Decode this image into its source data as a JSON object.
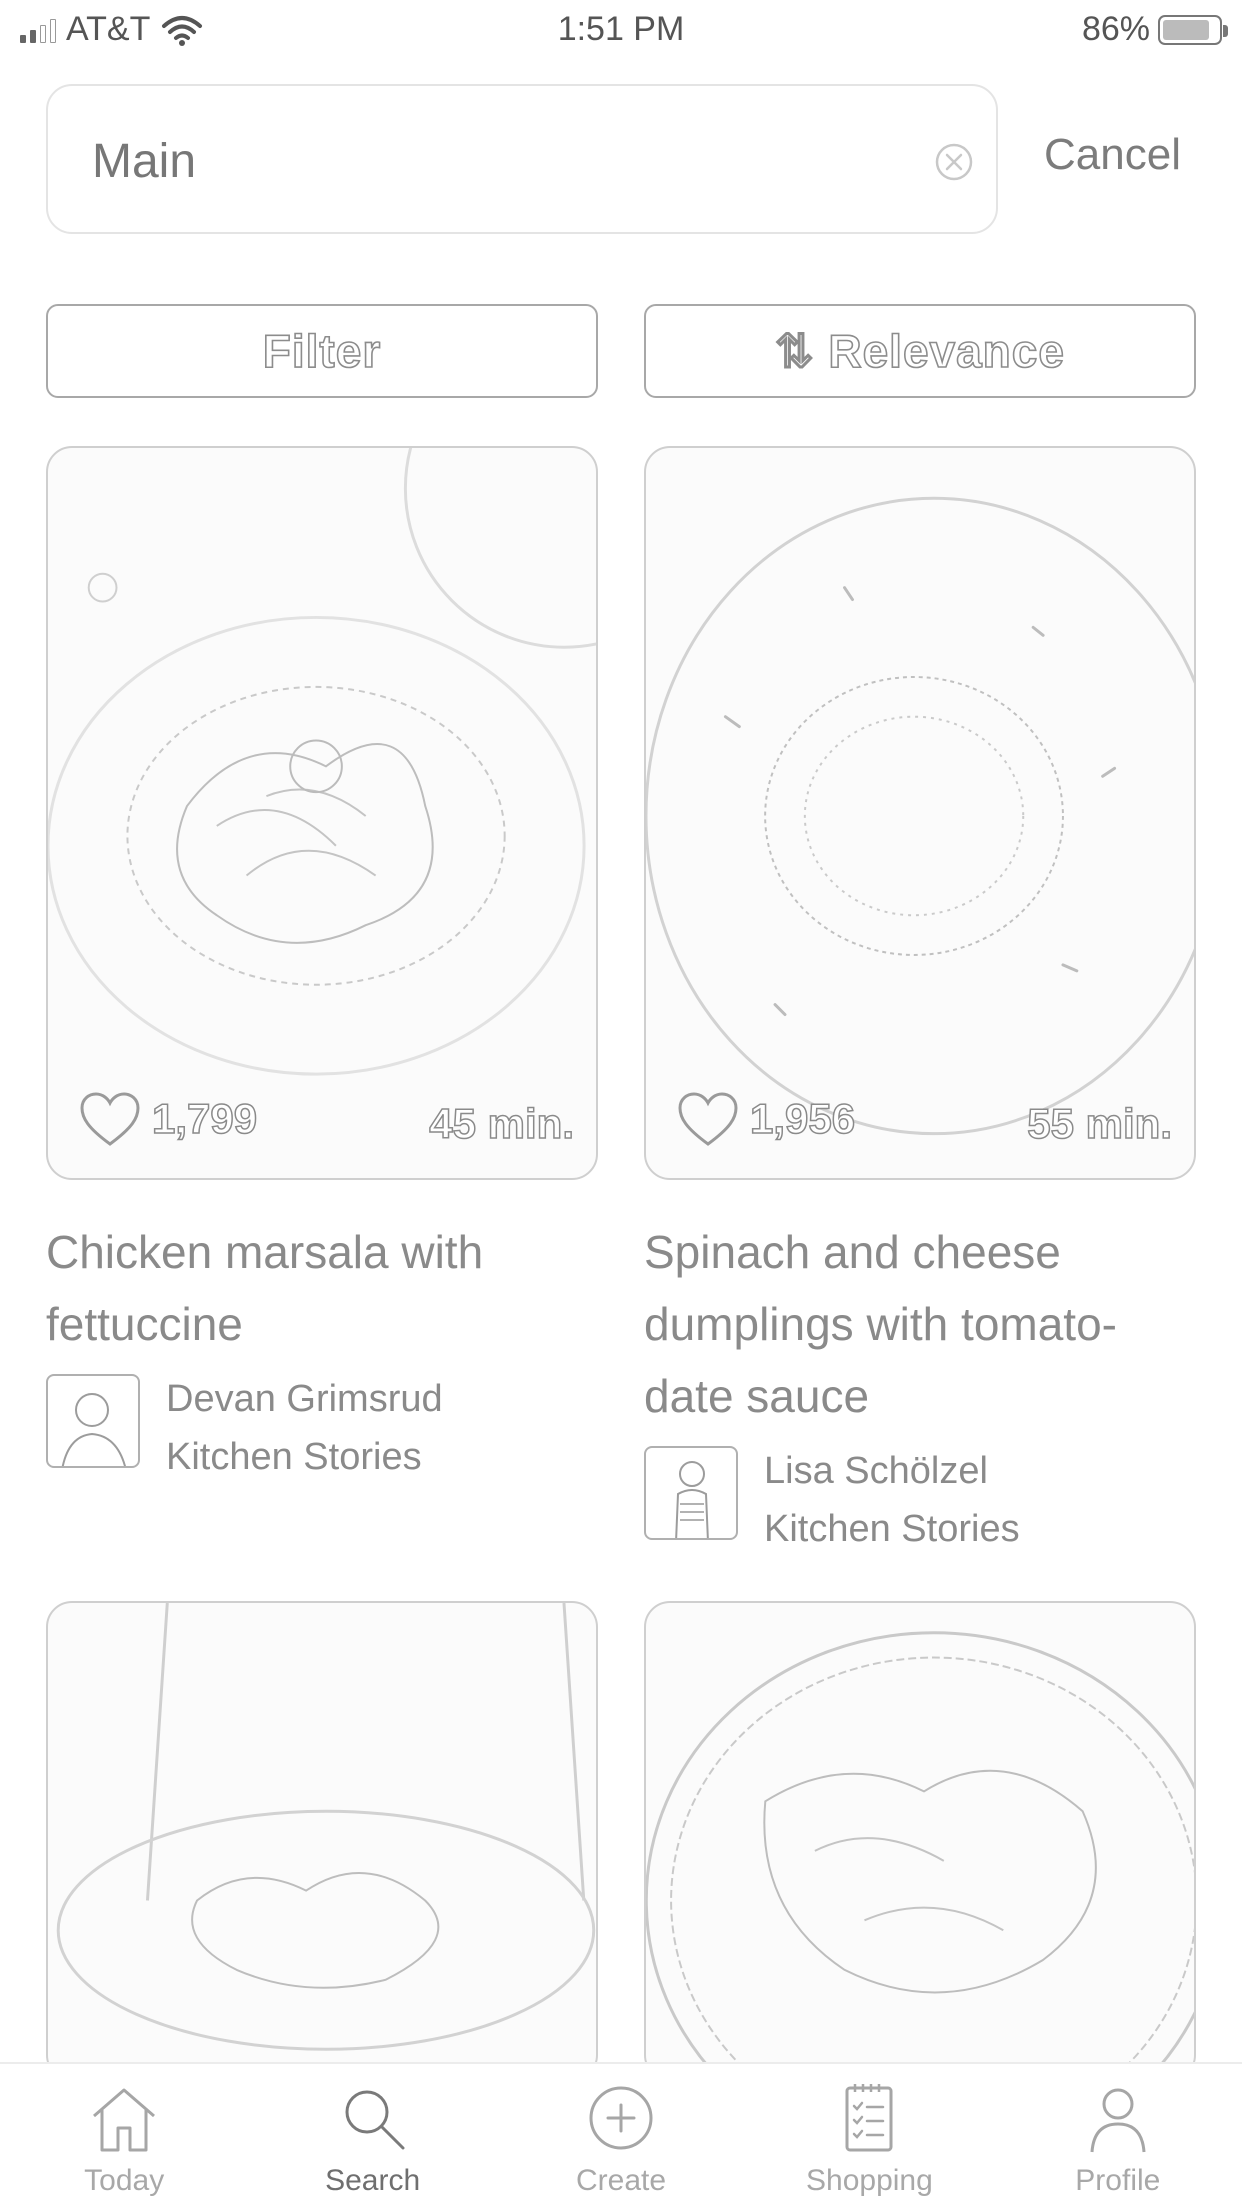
{
  "status_bar": {
    "carrier": "AT&T",
    "time": "1:51 PM",
    "battery_percent": "86%",
    "battery_level": 0.86
  },
  "search": {
    "query": "Main",
    "cancel_label": "Cancel"
  },
  "controls": {
    "filter_label": "Filter",
    "sort_label": "⇅ Relevance"
  },
  "recipes": [
    {
      "title": "Chicken marsala with fettuccine",
      "likes": "1,799",
      "duration": "45 min.",
      "author_name": "Devan Grimsrud",
      "author_org": "Kitchen Stories"
    },
    {
      "title": "Spinach and cheese dumplings with tomato-date sauce",
      "likes": "1,956",
      "duration": "55 min.",
      "author_name": "Lisa Schölzel",
      "author_org": "Kitchen Stories"
    }
  ],
  "tab_bar": {
    "items": [
      {
        "label": "Today",
        "icon": "home-icon"
      },
      {
        "label": "Search",
        "icon": "search-icon"
      },
      {
        "label": "Create",
        "icon": "plus-circle-icon"
      },
      {
        "label": "Shopping",
        "icon": "clipboard-list-icon"
      },
      {
        "label": "Profile",
        "icon": "person-icon"
      }
    ],
    "active": "Search"
  }
}
